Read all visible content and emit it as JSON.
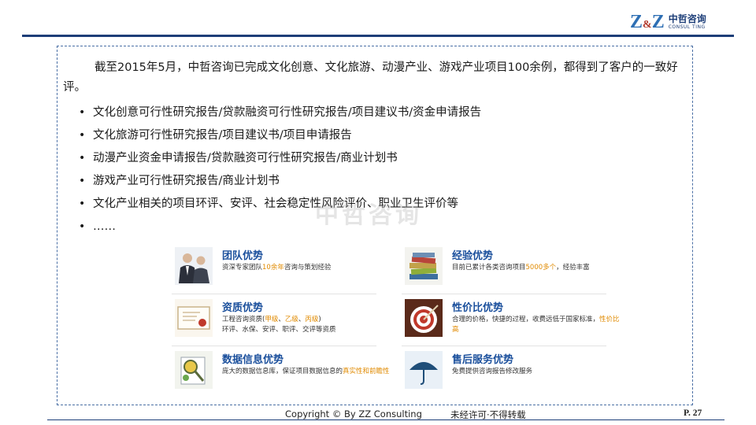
{
  "header": {
    "logo_mark_left": "Z",
    "logo_mark_amp": "&",
    "logo_mark_right": "Z",
    "logo_cn": "中哲咨询",
    "logo_en": "CONSUL TING",
    "accent_color": "#1d3e78"
  },
  "intro": "截至2015年5月，中哲咨询已完成文化创意、文化旅游、动漫产业、游戏产业项目100余例，都得到了客户的一致好评。",
  "bullets": [
    "文化创意可行性研究报告/贷款融资可行性研究报告/项目建议书/资金申请报告",
    "文化旅游可行性研究报告/项目建议书/项目申请报告",
    "动漫产业资金申请报告/贷款融资可行性研究报告/商业计划书",
    "游戏产业可行性研究报告/商业计划书",
    "文化产业相关的项目环评、安评、社会稳定性风险评价、职业卫生评价等",
    "……"
  ],
  "watermark": "中哲咨询",
  "advantages": {
    "team": {
      "title": "团队优势",
      "desc_a": "资深专家团队",
      "desc_hl": "10余年",
      "desc_b": "咨询与策划经验",
      "icon": "business-people-icon"
    },
    "experience": {
      "title": "经验优势",
      "desc_a": "目前已累计各类咨询项目",
      "desc_hl": "5000多个",
      "desc_b": "，经验丰富",
      "icon": "books-icon"
    },
    "qualification": {
      "title": "资质优势",
      "desc_a": "工程咨询资质(",
      "desc_hl1": "甲级",
      "desc_s1": "、",
      "desc_hl2": "乙级",
      "desc_s2": "、",
      "desc_hl3": "丙级",
      "desc_b": ")",
      "desc_c": "环评、水保、安评、职评、交评等资质",
      "icon": "certificate-icon"
    },
    "value": {
      "title": "性价比优势",
      "desc_a": "合理的价格，快捷的过程，收费远低于国家标准",
      "desc_s": "，",
      "desc_hl": "性价比高",
      "icon": "target-icon"
    },
    "data": {
      "title": "数据信息优势",
      "desc_a": "庞大的数据信息库，保证项目数据信息的",
      "desc_hl": "真实性和前瞻性",
      "icon": "magnifier-icon"
    },
    "service": {
      "title": "售后服务优势",
      "desc_a": "免费提供咨询报告修改服务",
      "icon": "umbrella-icon"
    }
  },
  "footer": {
    "copyright": "Copyright © By  ZZ  Consulting",
    "rights": "未经许可·不得转载",
    "page": "P. 27"
  }
}
